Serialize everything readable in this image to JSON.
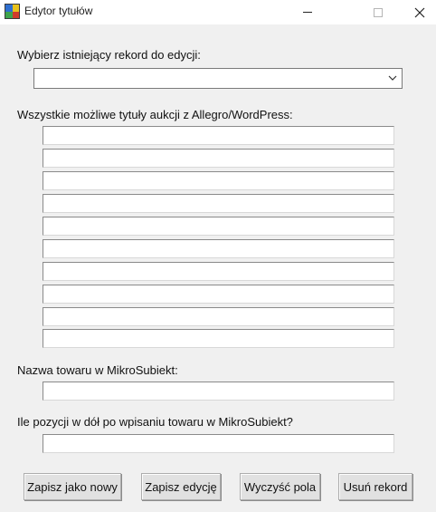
{
  "window": {
    "title": "Edytor tytułów",
    "icon": "app-grid-icon",
    "controls": [
      "minimize-icon",
      "maximize-icon",
      "close-icon"
    ]
  },
  "record_select": {
    "label": "Wybierz istniejący rekord do edycji:",
    "selected_value": ""
  },
  "titles_section": {
    "label": "Wszystkie możliwe tytuły aukcji z Allegro/WordPress:",
    "fields": [
      "",
      "",
      "",
      "",
      "",
      "",
      "",
      "",
      "",
      ""
    ]
  },
  "product_name": {
    "label": "Nazwa towaru w MikroSubiekt:",
    "value": ""
  },
  "positions_down": {
    "label": "Ile pozycji w dół po wpisaniu towaru w MikroSubiekt?",
    "value": ""
  },
  "buttons": {
    "save_new": "Zapisz jako nowy",
    "save_edit": "Zapisz edycję",
    "clear_fields": "Wyczyść pola",
    "delete_record": "Usuń rekord"
  }
}
